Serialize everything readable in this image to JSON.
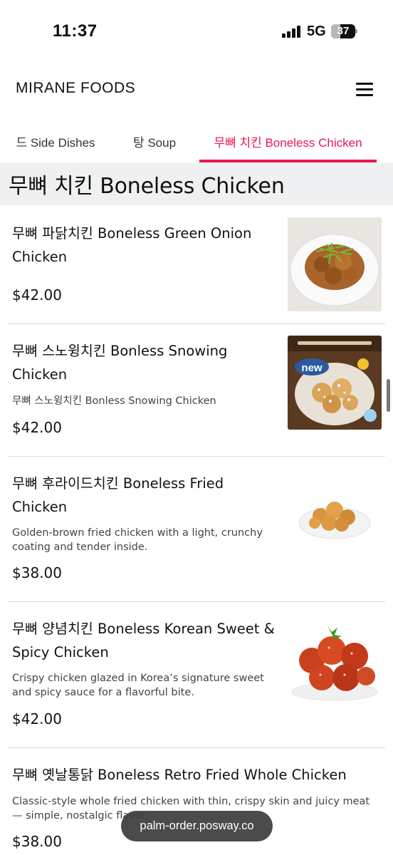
{
  "status_bar": {
    "time": "11:37",
    "network": "5G",
    "battery_percent": "37",
    "battery_level": 0.37
  },
  "header": {
    "brand": "MIRANE FOODS",
    "menu_icon": "hamburger-menu-icon"
  },
  "tabs": [
    {
      "label": "드 Side Dishes",
      "active": false
    },
    {
      "label": "탕 Soup",
      "active": false
    },
    {
      "label": "무뼈 치킨 Boneless Chicken",
      "active": true
    }
  ],
  "colors": {
    "accent": "#e8194f",
    "section_bg": "#eef0f2",
    "url_pill_bg": "#3c3c3c"
  },
  "section": {
    "title": "무뼈 치킨 Boneless Chicken"
  },
  "items": [
    {
      "title": "무뼈 파닭치킨 Boneless Green Onion Chicken",
      "description": "",
      "price": "$42.00"
    },
    {
      "title": "무뼈 스노윙치킨 Bonless Snowing Chicken",
      "description": "무뼈 스노윙치킨 Bonless Snowing Chicken",
      "price": "$42.00",
      "image_text": "new"
    },
    {
      "title": "무뼈 후라이드치킨 Boneless Fried Chicken",
      "description": "Golden-brown fried chicken with a light, crunchy coating and tender inside.",
      "price": "$38.00"
    },
    {
      "title": "무뼈 양념치킨 Boneless Korean Sweet & Spicy Chicken",
      "description": "Crispy chicken glazed in Korea’s signature sweet and spicy sauce for a flavorful bite.",
      "price": "$42.00"
    },
    {
      "title": "무뼈 옛날통닭 Boneless Retro Fried Whole Chicken",
      "description": "Classic-style whole fried chicken with thin, crispy skin and juicy meat — simple, nostalgic flavor.",
      "price": "$38.00"
    }
  ],
  "url_bar": {
    "text": "palm-order.posway.co"
  }
}
